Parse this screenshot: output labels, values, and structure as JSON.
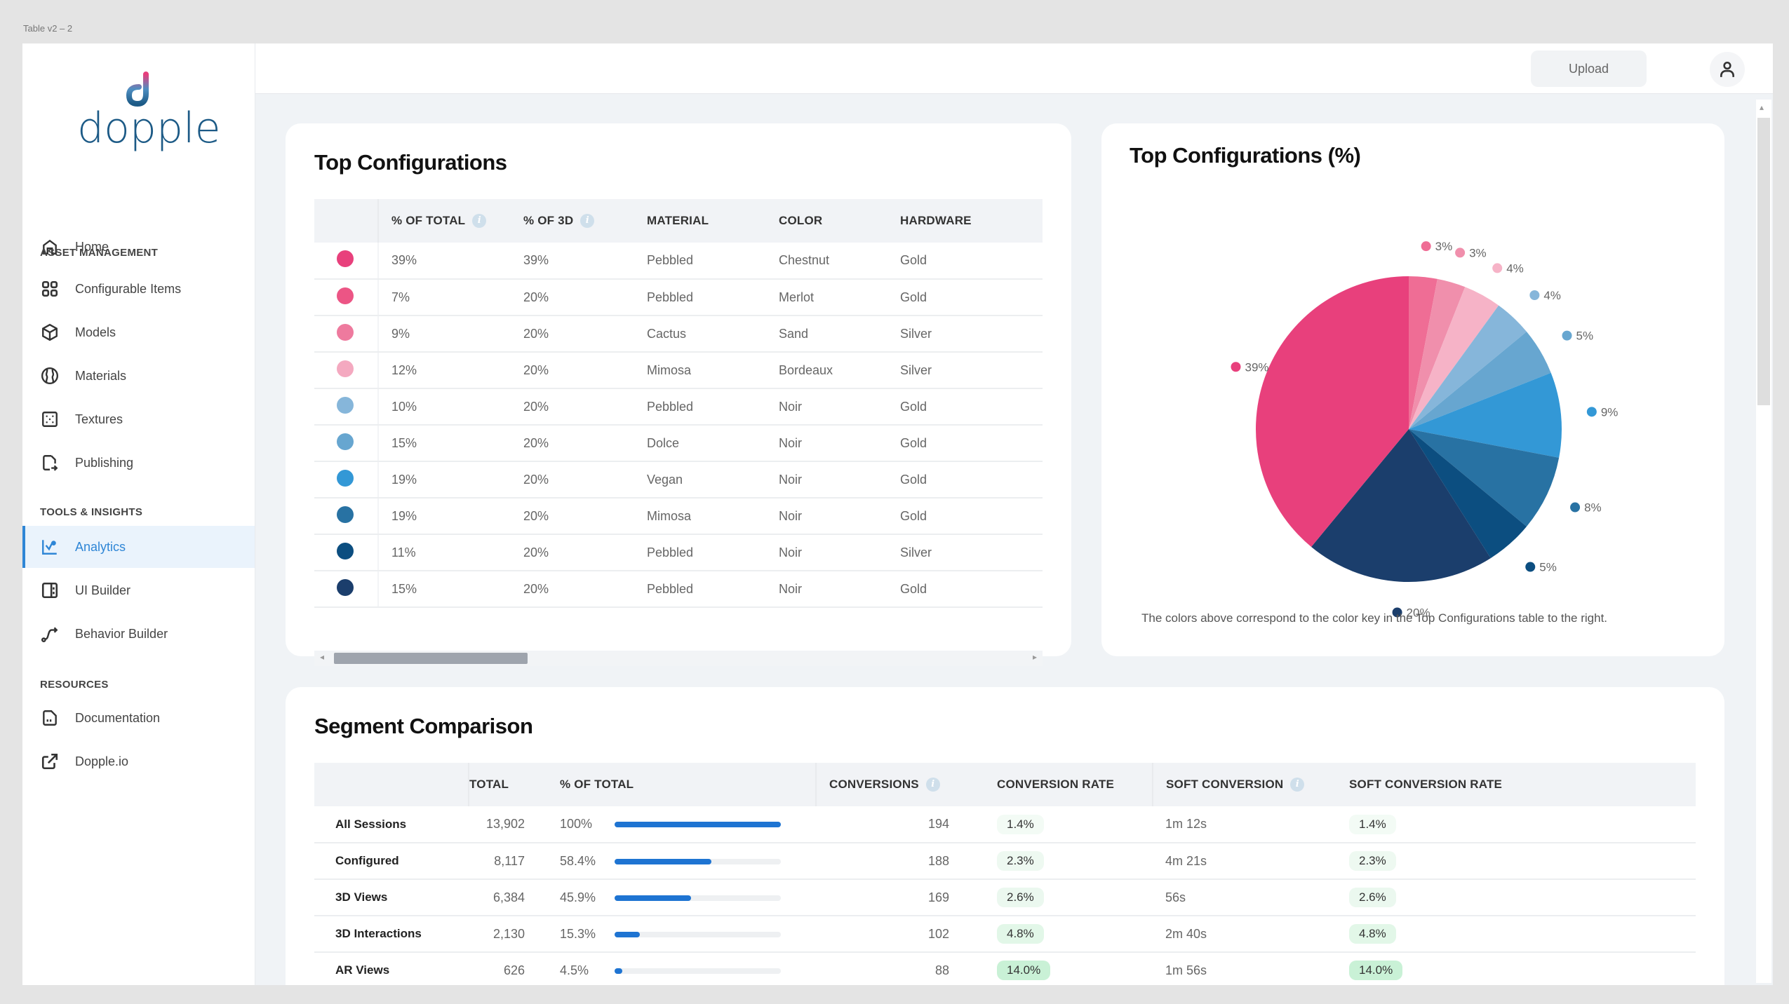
{
  "frame_label": "Table v2 – 2",
  "brand": {
    "name": "dopple",
    "primary_color": "#1c5a86",
    "accent_color": "#e83e7c"
  },
  "header": {
    "upload_label": "Upload",
    "user_icon": "user-icon"
  },
  "sidebar": {
    "home": {
      "label": "Home",
      "icon": "home-icon"
    },
    "sections": [
      {
        "title": "ASSET MANAGEMENT",
        "items": [
          {
            "label": "Configurable Items",
            "icon": "grid-icon"
          },
          {
            "label": "Models",
            "icon": "cube-icon"
          },
          {
            "label": "Materials",
            "icon": "material-ball-icon"
          },
          {
            "label": "Textures",
            "icon": "texture-icon"
          },
          {
            "label": "Publishing",
            "icon": "publish-file-icon"
          }
        ]
      },
      {
        "title": "TOOLS & INSIGHTS",
        "items": [
          {
            "label": "Analytics",
            "icon": "analytics-chart-icon",
            "active": true
          },
          {
            "label": "UI Builder",
            "icon": "layout-icon"
          },
          {
            "label": "Behavior Builder",
            "icon": "path-icon"
          }
        ]
      },
      {
        "title": "RESOURCES",
        "items": [
          {
            "label": "Documentation",
            "icon": "document-icon"
          },
          {
            "label": "Dopple.io",
            "icon": "external-link-icon"
          }
        ]
      }
    ]
  },
  "top_configurations": {
    "title": "Top Configurations",
    "columns": [
      "% OF TOTAL",
      "% OF 3D",
      "MATERIAL",
      "COLOR",
      "HARDWARE"
    ],
    "rows": [
      {
        "color": "#e8407c",
        "pct_total": "39%",
        "pct_3d": "39%",
        "material": "Pebbled",
        "color_name": "Chestnut",
        "hardware": "Gold"
      },
      {
        "color": "#ec5585",
        "pct_total": "7%",
        "pct_3d": "20%",
        "material": "Pebbled",
        "color_name": "Merlot",
        "hardware": "Gold"
      },
      {
        "color": "#ee7a9e",
        "pct_total": "9%",
        "pct_3d": "20%",
        "material": "Cactus",
        "color_name": "Sand",
        "hardware": "Silver"
      },
      {
        "color": "#f4a9c0",
        "pct_total": "12%",
        "pct_3d": "20%",
        "material": "Mimosa",
        "color_name": "Bordeaux",
        "hardware": "Silver"
      },
      {
        "color": "#86b6da",
        "pct_total": "10%",
        "pct_3d": "20%",
        "material": "Pebbled",
        "color_name": "Noir",
        "hardware": "Gold"
      },
      {
        "color": "#67a6d0",
        "pct_total": "15%",
        "pct_3d": "20%",
        "material": "Dolce",
        "color_name": "Noir",
        "hardware": "Gold"
      },
      {
        "color": "#3398d6",
        "pct_total": "19%",
        "pct_3d": "20%",
        "material": "Vegan",
        "color_name": "Noir",
        "hardware": "Gold"
      },
      {
        "color": "#2872a3",
        "pct_total": "19%",
        "pct_3d": "20%",
        "material": "Mimosa",
        "color_name": "Noir",
        "hardware": "Gold"
      },
      {
        "color": "#0c4e80",
        "pct_total": "11%",
        "pct_3d": "20%",
        "material": "Pebbled",
        "color_name": "Noir",
        "hardware": "Silver"
      },
      {
        "color": "#1b3e6c",
        "pct_total": "15%",
        "pct_3d": "20%",
        "material": "Pebbled",
        "color_name": "Noir",
        "hardware": "Gold"
      }
    ],
    "scroll_position": 0
  },
  "chart_data": {
    "type": "pie",
    "title": "Top Configurations (%)",
    "start": "top, clockwise",
    "slices": [
      {
        "label": "3%",
        "value": 3,
        "color": "#ef6d95"
      },
      {
        "label": "3%",
        "value": 3,
        "color": "#f08fac"
      },
      {
        "label": "4%",
        "value": 4,
        "color": "#f6b3c7"
      },
      {
        "label": "4%",
        "value": 4,
        "color": "#86b6da"
      },
      {
        "label": "5%",
        "value": 5,
        "color": "#67a6d0"
      },
      {
        "label": "9%",
        "value": 9,
        "color": "#3398d6"
      },
      {
        "label": "8%",
        "value": 8,
        "color": "#2872a3"
      },
      {
        "label": "5%",
        "value": 5,
        "color": "#0c4e80"
      },
      {
        "label": "20%",
        "value": 20,
        "color": "#1b3e6c"
      },
      {
        "label": "39%",
        "value": 39,
        "color": "#e8407c"
      }
    ],
    "note": "The colors above correspond to the color key in the Top Configurations table to the right."
  },
  "segment_comparison": {
    "title": "Segment Comparison",
    "columns": [
      "",
      "TOTAL",
      "% OF TOTAL",
      "CONVERSIONS",
      "CONVERSION RATE",
      "SOFT CONVERSION",
      "SOFT CONVERSION RATE"
    ],
    "rows": [
      {
        "name": "All Sessions",
        "total": "13,902",
        "pct": "100%",
        "pct_value": 100,
        "conversions": "194",
        "conv_rate": "1.4%",
        "soft_conv": "1m 12s",
        "soft_rate": "1.4%",
        "tint": "#f3fbf5"
      },
      {
        "name": "Configured",
        "total": "8,117",
        "pct": "58.4%",
        "pct_value": 58.4,
        "conversions": "188",
        "conv_rate": "2.3%",
        "soft_conv": "4m 21s",
        "soft_rate": "2.3%",
        "tint": "#eef9f1"
      },
      {
        "name": "3D Views",
        "total": "6,384",
        "pct": "45.9%",
        "pct_value": 45.9,
        "conversions": "169",
        "conv_rate": "2.6%",
        "soft_conv": "56s",
        "soft_rate": "2.6%",
        "tint": "#ebf8ef"
      },
      {
        "name": "3D Interactions",
        "total": "2,130",
        "pct": "15.3%",
        "pct_value": 15.3,
        "conversions": "102",
        "conv_rate": "4.8%",
        "soft_conv": "2m 40s",
        "soft_rate": "4.8%",
        "tint": "#e2f7e8"
      },
      {
        "name": "AR Views",
        "total": "626",
        "pct": "4.5%",
        "pct_value": 4.5,
        "conversions": "88",
        "conv_rate": "14.0%",
        "soft_conv": "1m 56s",
        "soft_rate": "14.0%",
        "tint": "#c9f1d6"
      }
    ]
  }
}
